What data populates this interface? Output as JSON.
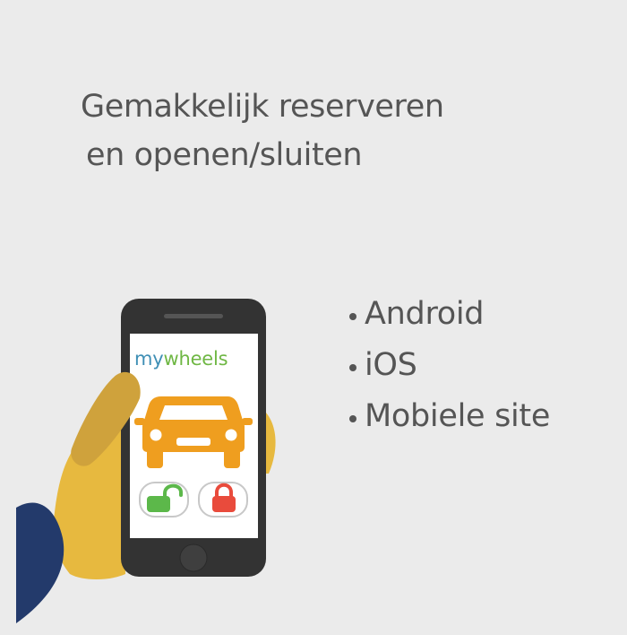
{
  "headline": {
    "line1": "Gemakkelijk reserveren",
    "line2": "en openen/sluiten"
  },
  "features": [
    "Android",
    "iOS",
    "Mobiele site"
  ],
  "phone": {
    "logo_my": "my",
    "logo_wheels": "wheels",
    "icons": {
      "car": "car-icon",
      "unlock": "unlock-icon",
      "lock": "lock-icon"
    }
  },
  "colors": {
    "background": "#ebebeb",
    "text": "#555555",
    "phone_body": "#333333",
    "car": "#ef9e1f",
    "unlock": "#5cb84a",
    "lock": "#e94b3c",
    "hand": "#e7b93f",
    "thumb": "#cfa23c",
    "sleeve": "#233a6b",
    "logo_my": "#3f8fb5",
    "logo_wheels": "#6fb744"
  }
}
